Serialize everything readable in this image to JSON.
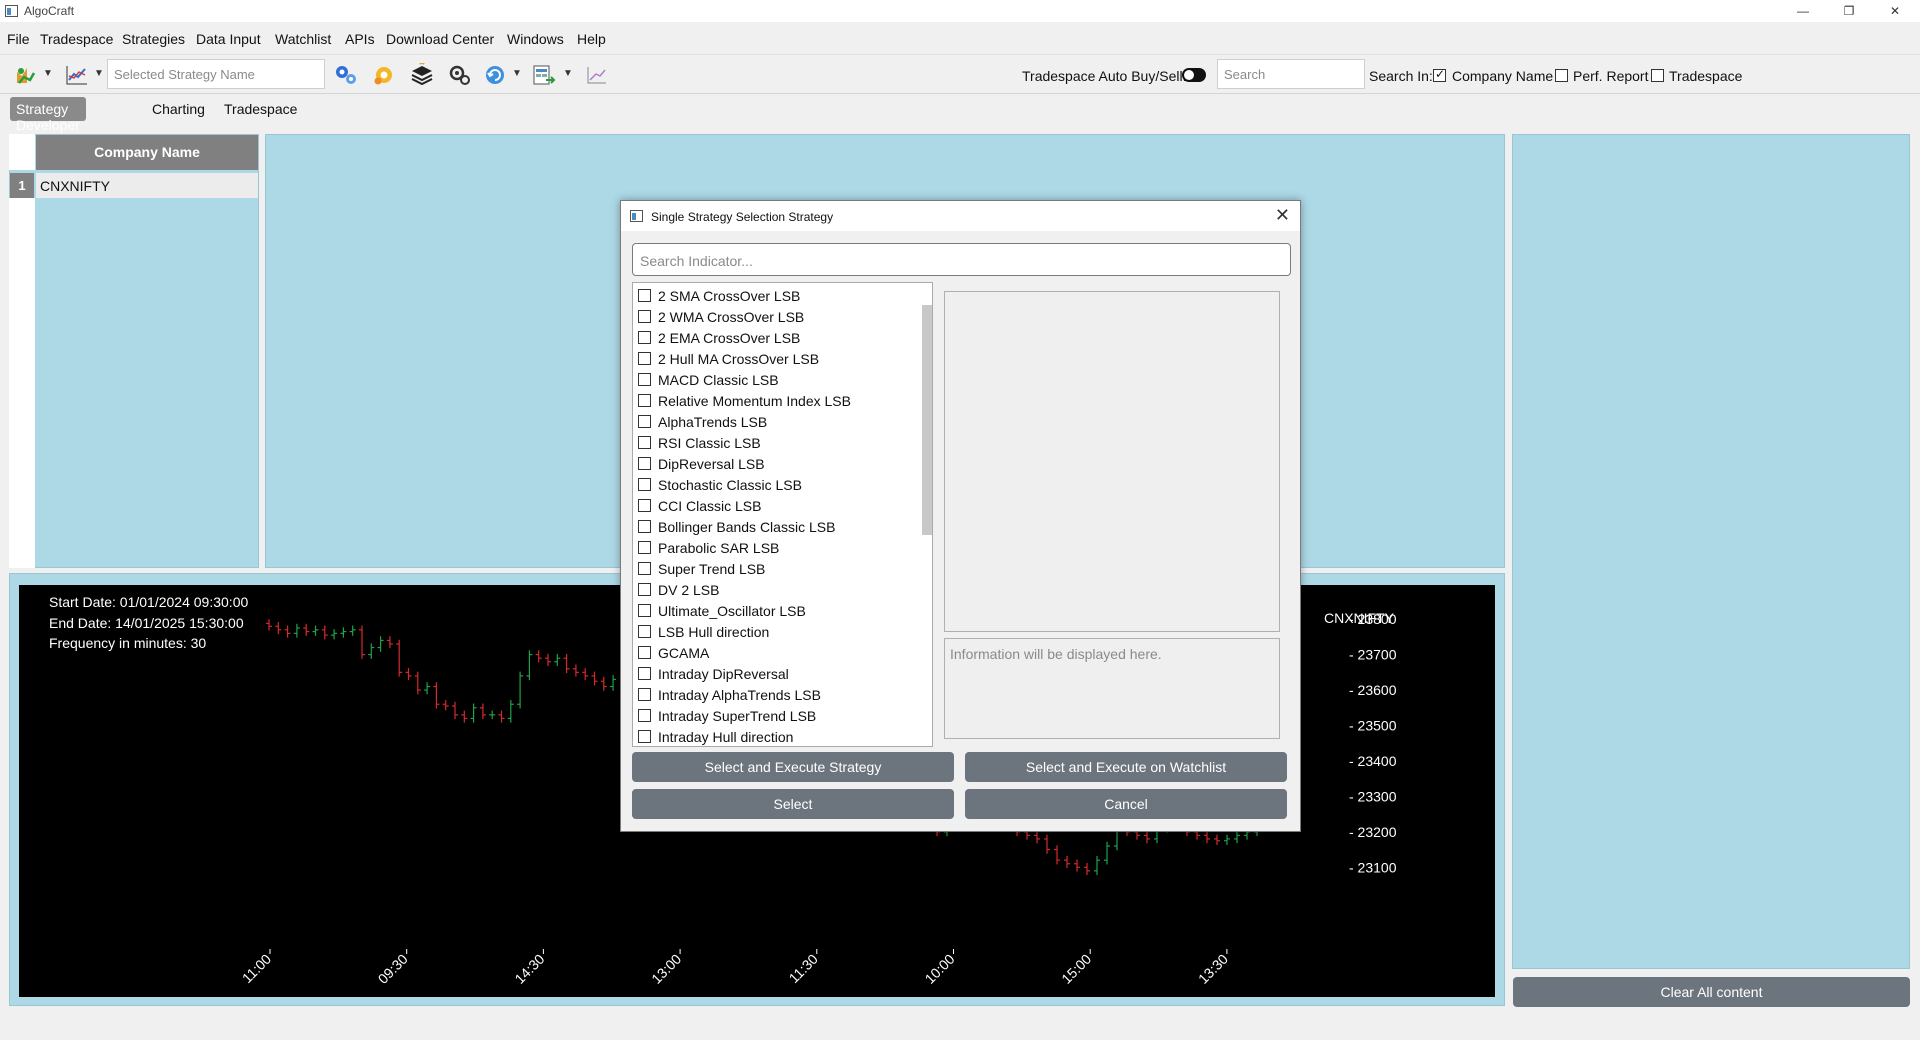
{
  "window": {
    "title": "AlgoCraft",
    "controls": {
      "minimize": "—",
      "restore": "❐",
      "close": "✕"
    }
  },
  "menu": [
    "File",
    "Tradespace",
    "Strategies",
    "Data Input",
    "Watchlist",
    "APIs",
    "Download Center",
    "Windows",
    "Help"
  ],
  "toolbar": {
    "strategy_placeholder": "Selected Strategy Name",
    "auto_label": "Tradespace Auto Buy/Sell:",
    "auto_enabled": true,
    "search_placeholder": "Search",
    "search_in_label": "Search In:",
    "filters": [
      {
        "label": "Company Name",
        "checked": true
      },
      {
        "label": "Perf. Report",
        "checked": false
      },
      {
        "label": "Tradespace",
        "checked": false
      }
    ]
  },
  "tabs": [
    {
      "label": "Strategy Developer",
      "active": true
    },
    {
      "label": "Charting",
      "active": false
    },
    {
      "label": "Tradespace",
      "active": false
    }
  ],
  "company_table": {
    "header": "Company Name",
    "rows": [
      {
        "num": "1",
        "name": "CNXNIFTY"
      }
    ]
  },
  "chart_info": {
    "start": "Start Date: 01/01/2024 09:30:00",
    "end": "End Date: 14/01/2025 15:30:00",
    "frequency": "Frequency in minutes: 30",
    "symbol": "CNXNIFTY"
  },
  "chart_data": {
    "type": "candlestick",
    "title": "CNXNIFTY",
    "xlabel": "",
    "ylabel": "",
    "x_tick_labels": [
      "11:00",
      "09:30",
      "14:30",
      "13:00",
      "11:30",
      "10:00",
      "15:00",
      "13:30"
    ],
    "y_ticks": [
      23100,
      23200,
      23300,
      23400,
      23500,
      23600,
      23700,
      23800
    ],
    "ylim": [
      23050,
      23840
    ],
    "up_color": "#1fa24a",
    "down_color": "#d62a2a",
    "close_series_left": [
      23780,
      23770,
      23760,
      23775,
      23765,
      23770,
      23755,
      23760,
      23765,
      23770,
      23700,
      23720,
      23740,
      23730,
      23650,
      23640,
      23600,
      23610,
      23560,
      23555,
      23530,
      23520,
      23550,
      23530,
      23530,
      23520,
      23560,
      23640,
      23700,
      23690,
      23680,
      23690,
      23660,
      23650,
      23640,
      23625,
      23610,
      23630
    ],
    "close_series_right": [
      23200,
      23230,
      23260,
      23280,
      23260,
      23240,
      23230,
      23220,
      23200,
      23190,
      23180,
      23150,
      23120,
      23110,
      23100,
      23090,
      23120,
      23160,
      23210,
      23200,
      23190,
      23180,
      23210,
      23240,
      23230,
      23200,
      23190,
      23180,
      23175,
      23180,
      23190,
      23200,
      23210
    ]
  },
  "dialog": {
    "title": "Single Strategy Selection Strategy",
    "search_placeholder": "Search Indicator...",
    "strategies": [
      "2 SMA CrossOver LSB",
      "2 WMA CrossOver LSB",
      "2 EMA CrossOver LSB",
      "2 Hull MA CrossOver LSB",
      "MACD Classic LSB",
      "Relative Momentum Index LSB",
      "AlphaTrends LSB",
      "RSI Classic LSB",
      "DipReversal LSB",
      "Stochastic Classic LSB",
      "CCI Classic LSB",
      "Bollinger Bands Classic LSB",
      "Parabolic SAR LSB",
      "Super Trend LSB",
      "DV 2 LSB",
      "Ultimate_Oscillator LSB",
      "LSB Hull direction",
      "GCAMA",
      "Intraday DipReversal",
      "Intraday AlphaTrends LSB",
      "Intraday SuperTrend LSB",
      "Intraday Hull direction"
    ],
    "info_placeholder": "Information will be displayed here.",
    "buttons": {
      "execute": "Select and Execute Strategy",
      "execute_watchlist": "Select and Execute on Watchlist",
      "select": "Select",
      "cancel": "Cancel"
    }
  },
  "clear_button": "Clear All content"
}
